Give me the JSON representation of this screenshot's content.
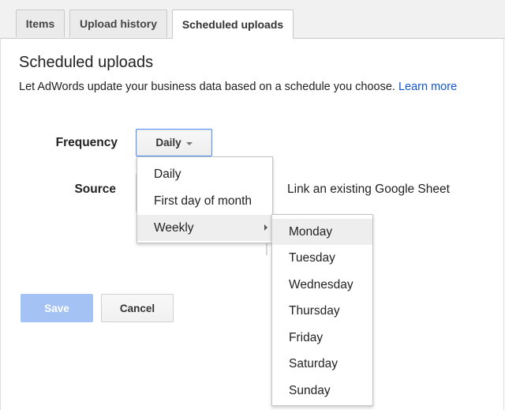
{
  "tabs": [
    {
      "label": "Items"
    },
    {
      "label": "Upload history"
    },
    {
      "label": "Scheduled uploads",
      "active": true
    }
  ],
  "page": {
    "title": "Scheduled uploads",
    "description": "Let AdWords update your business data based on a schedule you choose.",
    "learn_more": "Learn more"
  },
  "form": {
    "frequency_label": "Frequency",
    "frequency_value": "Daily",
    "source_label": "Source",
    "source_text": "Link an existing Google Sheet"
  },
  "frequency_menu": {
    "items": [
      {
        "label": "Daily"
      },
      {
        "label": "First day of month"
      },
      {
        "label": "Weekly",
        "highlighted": true,
        "has_submenu": true
      }
    ]
  },
  "day_menu": {
    "items": [
      {
        "label": "Monday",
        "highlighted": true
      },
      {
        "label": "Tuesday"
      },
      {
        "label": "Wednesday"
      },
      {
        "label": "Thursday"
      },
      {
        "label": "Friday"
      },
      {
        "label": "Saturday"
      },
      {
        "label": "Sunday"
      }
    ]
  },
  "buttons": {
    "save": "Save",
    "cancel": "Cancel"
  },
  "colors": {
    "link": "#1155cc",
    "focus_border": "#4d90fe",
    "save_disabled": "#a4c2f4"
  }
}
